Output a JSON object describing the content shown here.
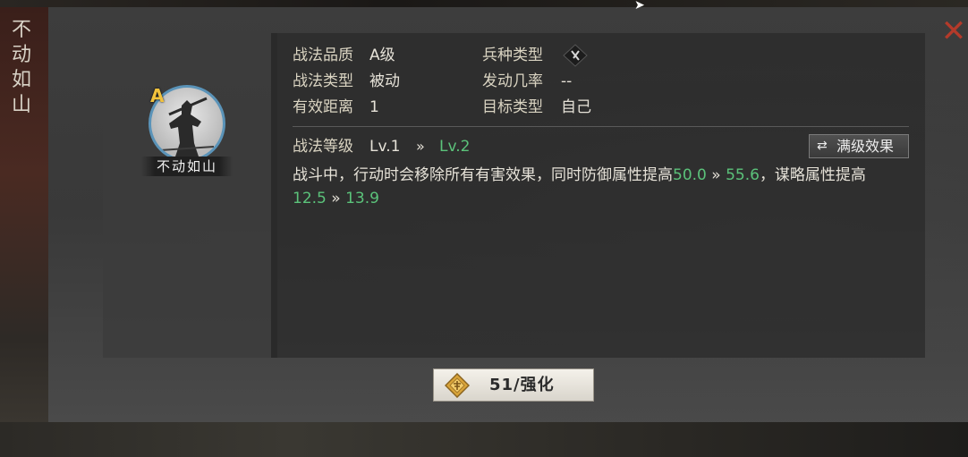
{
  "window": {
    "side_title": [
      "不",
      "动",
      "如",
      "山"
    ],
    "close_symbol": "✕"
  },
  "skill": {
    "name": "不动如山",
    "grade_badge": "A"
  },
  "attributes": [
    {
      "label": "战法品质",
      "value": "A级"
    },
    {
      "label": "战法类型",
      "value": "被动"
    },
    {
      "label": "有效距离",
      "value": "1"
    },
    {
      "label": "兵种类型",
      "icon": "troop-type-icon"
    },
    {
      "label": "发动几率",
      "value": "--"
    },
    {
      "label": "目标类型",
      "value": "自己"
    }
  ],
  "level": {
    "label": "战法等级",
    "current": "Lv.1",
    "arrow": "»",
    "next": "Lv.2"
  },
  "full_effect_button": {
    "label": "满级效果",
    "icon": "swap-icon"
  },
  "description": {
    "text1": "战斗中，行动时会移除所有有害效果，同时防御属性提高",
    "val1_from": "50.0",
    "arrow": " » ",
    "val1_to": "55.6",
    "text2": "，谋略属性提高",
    "val2_from": "12.5",
    "val2_to": "13.9"
  },
  "enhance_button": {
    "label": "51/强化",
    "icon": "gold-coin-icon"
  },
  "colors": {
    "accent_green": "#5bc27a",
    "close_red": "#b43a2a",
    "grade_gold": "#f2c23c"
  }
}
